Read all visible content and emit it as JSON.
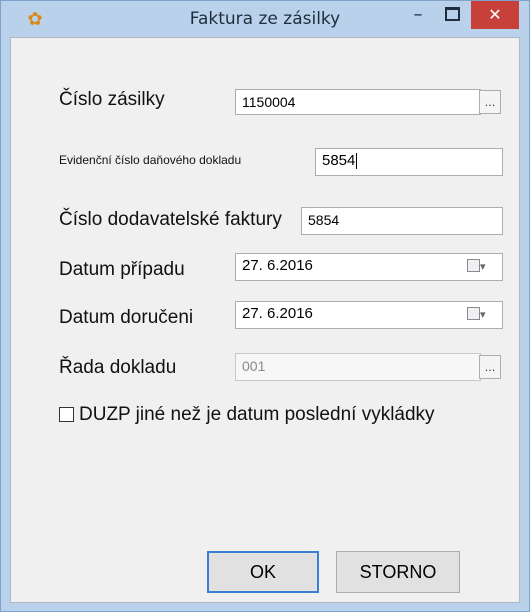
{
  "window": {
    "title": "Faktura ze zásilky",
    "minimize_glyph": "–",
    "close_glyph": "✕"
  },
  "form": {
    "cislo_zasilky": {
      "label": "Číslo zásilky",
      "value": "1150004",
      "button": "..."
    },
    "evidencni_cislo": {
      "label": "Evidenční číslo daňového dokladu",
      "value": "5854"
    },
    "cislo_dodavatelske": {
      "label": "Číslo dodavatelské faktury",
      "value": "5854"
    },
    "datum_pripadu": {
      "label": "Datum případu",
      "value": "27. 6.2016",
      "dropdown": "▾"
    },
    "datum_doruceni": {
      "label": "Datum doručeni",
      "value": "27. 6.2016",
      "dropdown": "▾"
    },
    "rada_dokladu": {
      "label": "Řada dokladu",
      "value": "001",
      "button": "..."
    },
    "duzp_checkbox": {
      "label": "DUZP jiné než je datum poslední vykládky",
      "checked": false
    }
  },
  "buttons": {
    "ok": "OK",
    "storno": "STORNO"
  },
  "colors": {
    "frame": "#b9d1ea",
    "client": "#f0f0f0",
    "close": "#c7403a",
    "ok_border": "#3c7fd1"
  },
  "icons": {
    "app": "gear-icon",
    "calendar": "calendar-icon",
    "dropdown": "chevron-down-icon"
  }
}
